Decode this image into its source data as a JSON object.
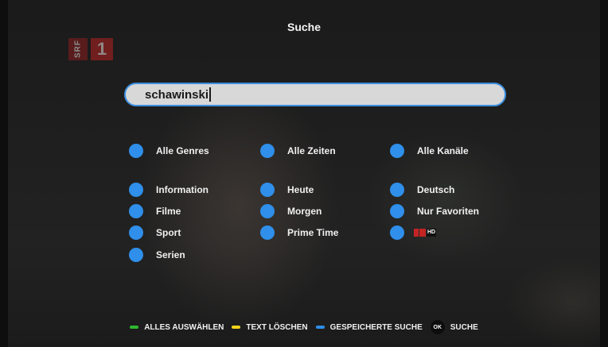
{
  "header": {
    "title": "Suche"
  },
  "channel_logo": {
    "text": "SRF",
    "number": "1"
  },
  "search": {
    "value": "schawinski"
  },
  "filters": {
    "genres": [
      {
        "label": "Alle Genres"
      },
      {
        "label": "Information"
      },
      {
        "label": "Filme"
      },
      {
        "label": "Sport"
      },
      {
        "label": "Serien"
      }
    ],
    "times": [
      {
        "label": "Alle Zeiten"
      },
      {
        "label": "Heute"
      },
      {
        "label": "Morgen"
      },
      {
        "label": "Prime Time"
      }
    ],
    "channels": [
      {
        "label": "Alle Kanäle"
      },
      {
        "label": "Deutsch"
      },
      {
        "label": "Nur Favoriten"
      },
      {
        "label": "",
        "logo": "SRF 1 HD"
      }
    ]
  },
  "footer": {
    "select_all": "ALLES AUSWÄHLEN",
    "clear_text": "TEXT LÖSCHEN",
    "saved_search": "GESPEICHERTE SUCHE",
    "ok_key": "OK",
    "search": "SUCHE"
  },
  "colors": {
    "accent": "#2f8fea",
    "green_key": "#2eb82e",
    "yellow_key": "#f2d21c",
    "blue_key": "#2f8fea"
  }
}
